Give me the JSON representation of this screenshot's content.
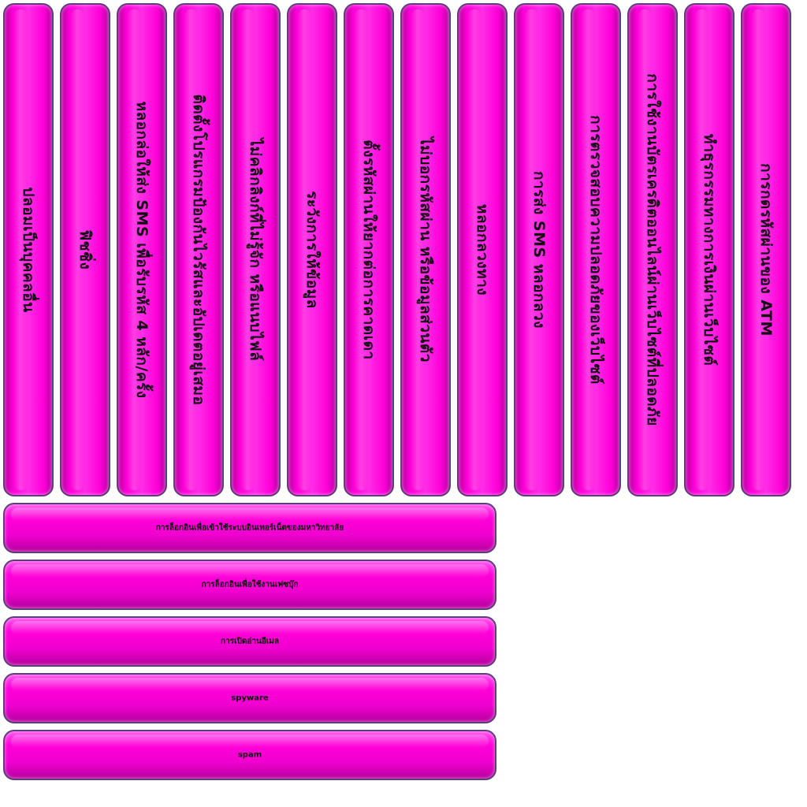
{
  "accent_color": "#ff00d8",
  "border_color": "#5e3c7e",
  "vertical_options": [
    "ปลอมเป็นบุคคลอื่น",
    "ฟิชชิ่ง",
    "หลอกล่อให้ส่ง SMS เพื่อรับรหัส 4 หลัก/ครั้ง",
    "ติดตั้งโปรแกรมป้องกันไวรัสและอัปเดตอยู่เสมอ",
    "ไม่คลิกลิงก์ที่ไม่รู้จัก หรือแนบไฟล์",
    "ระวังการให้ข้อมูล",
    "ตั้งรหัสผ่านให้ยากต่อการคาดเดา",
    "ไม่บอกรหัสผ่าน หรือข้อมูลส่วนตัว",
    "หลอกลวงทาง",
    "การส่ง SMS หลอกลวง",
    "การตรวจสอบความปลอดภัยของเว็บไซต์",
    "การใช้งานบัตรเครดิตออนไลน์ผ่านเว็บไซต์ที่ปลอดภัย",
    "ทำธุรกรรมทางการเงินผ่านเว็บไซต์",
    "การกดรหัสผ่านของ ATM"
  ],
  "horizontal_options": [
    "การล็อกอินเพื่อเข้าใช้ระบบอินเทอร์เน็ตของมหาวิทยาลัย",
    "การล็อกอินเพื่อใช้งานเฟซบุ๊ก",
    "การเปิดอ่านอีเมล",
    "spyware",
    "spam"
  ]
}
